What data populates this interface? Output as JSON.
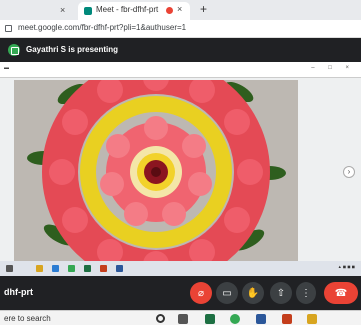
{
  "browser": {
    "prev_tab_close": "×",
    "tab_title": "Meet - fbr-dfhf-prt",
    "tab_close": "×",
    "new_tab": "+",
    "url": "meet.google.com/fbr-dfhf-prt?pli=1&authuser=1"
  },
  "meet": {
    "presenting": "Gayathri S is presenting",
    "meeting_code": "dhf-prt"
  },
  "screen": {
    "next_arrow": "›"
  },
  "controls": {
    "mic": "⌀",
    "camera": "▭",
    "hand": "✋",
    "present": "⇧",
    "more": "⋮",
    "end": "☎"
  },
  "win_taskbar": {
    "search_text": "ere to search"
  },
  "colors": {
    "red_accent": "#ea4335",
    "meet_dark": "#202124",
    "presenting_green": "#34a853"
  }
}
